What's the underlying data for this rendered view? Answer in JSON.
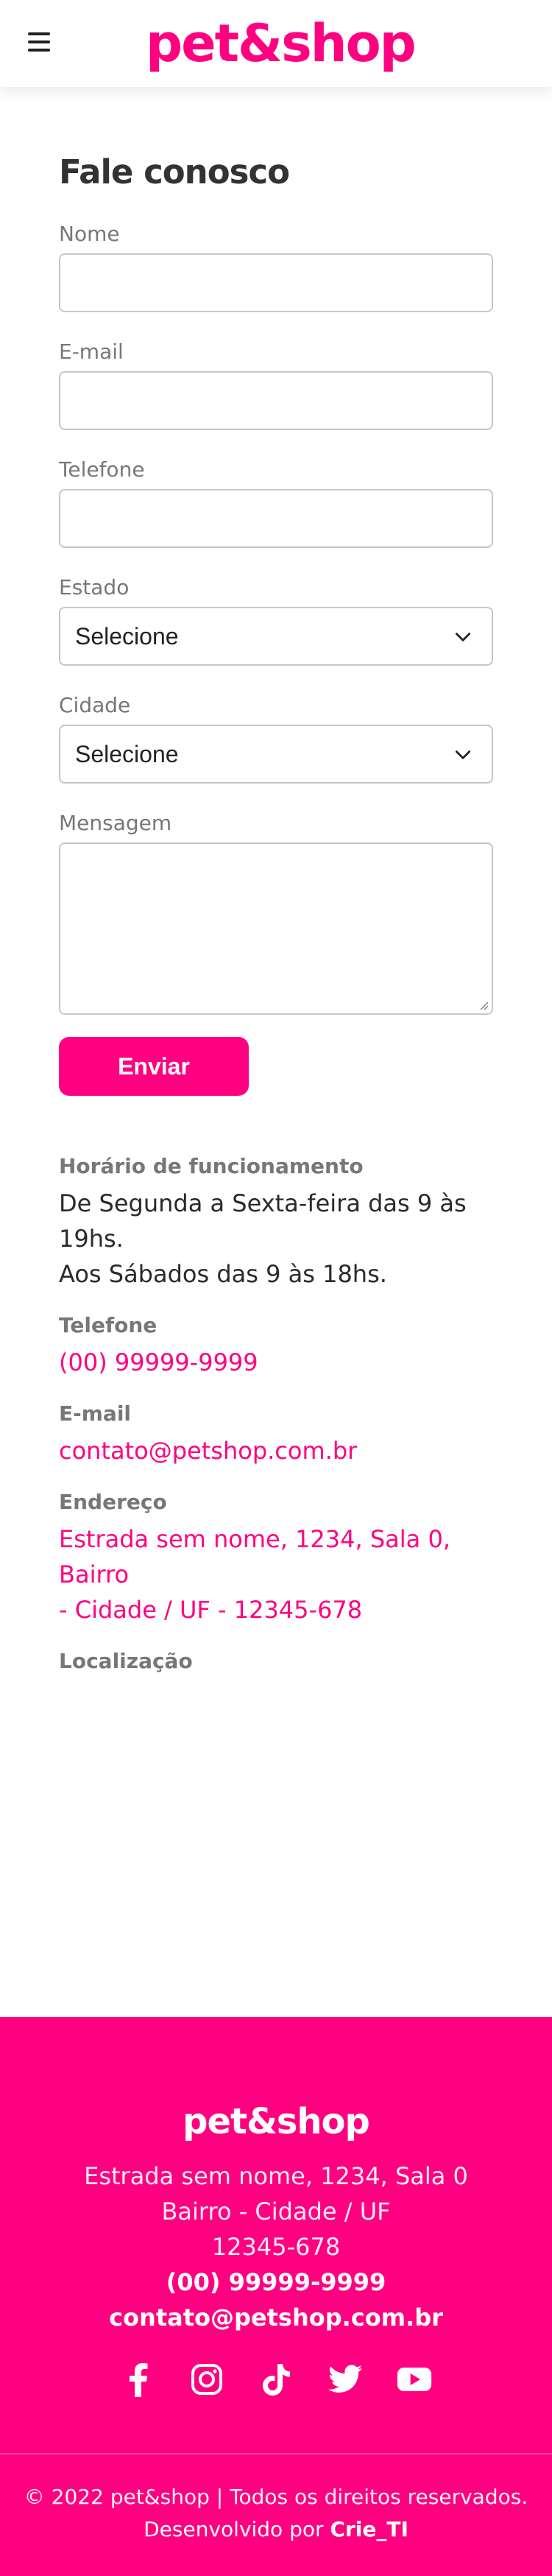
{
  "header": {
    "logo": "pet&shop",
    "menu_icon": "hamburger-menu-icon"
  },
  "contact": {
    "title": "Fale conosco",
    "fields": {
      "nome_label": "Nome",
      "email_label": "E-mail",
      "telefone_label": "Telefone",
      "estado_label": "Estado",
      "estado_value": "Selecione",
      "cidade_label": "Cidade",
      "cidade_value": "Selecione",
      "mensagem_label": "Mensagem"
    },
    "submit_label": "Enviar"
  },
  "info": {
    "horario_label": "Horário de funcionamento",
    "horario_line1": "De Segunda a Sexta-feira das 9 às 19hs.",
    "horario_line2": "Aos Sábados das 9 às 18hs.",
    "telefone_label": "Telefone",
    "telefone_value": "(00) 99999-9999",
    "email_label": "E-mail",
    "email_value": "contato@petshop.com.br",
    "endereco_label": "Endereço",
    "endereco_line1": "Estrada sem nome, 1234, Sala 0, Bairro",
    "endereco_line2": "- Cidade / UF - 12345-678",
    "localizacao_label": "Localização"
  },
  "footer": {
    "logo": "pet&shop",
    "address_line1": "Estrada sem nome, 1234, Sala 0",
    "address_line2": "Bairro - Cidade / UF",
    "address_line3": "12345-678",
    "phone": "(00) 99999-9999",
    "email": "contato@petshop.com.br",
    "socials": [
      "facebook-icon",
      "instagram-icon",
      "tiktok-icon",
      "twitter-icon",
      "youtube-icon"
    ],
    "copyright": "© 2022 pet&shop | Todos os direitos reservados.",
    "dev_prefix": "Desenvolvido por",
    "dev_name": "Crie_TI"
  },
  "colors": {
    "brand": "#ff0080",
    "text": "#3a3a3a",
    "label": "#777777",
    "border": "#c6c6c6"
  }
}
